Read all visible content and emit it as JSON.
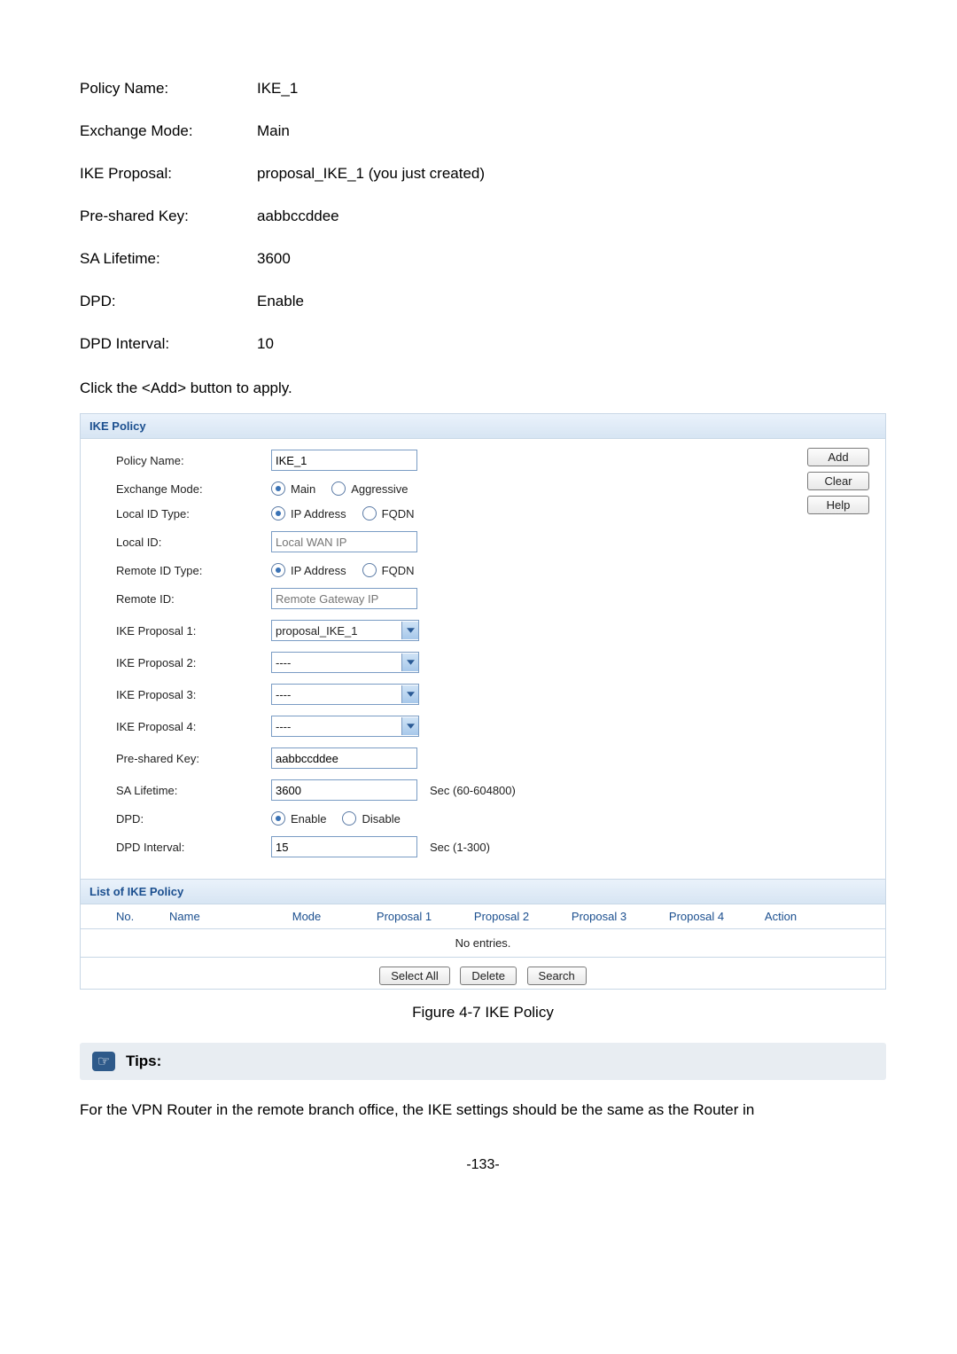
{
  "spec": {
    "rows": [
      {
        "label": "Policy Name:",
        "value": "IKE_1"
      },
      {
        "label": "Exchange Mode:",
        "value": "Main"
      },
      {
        "label": "IKE Proposal:",
        "value": "proposal_IKE_1 (you just created)"
      },
      {
        "label": "Pre-shared Key:",
        "value": "aabbccddee"
      },
      {
        "label": "SA Lifetime:",
        "value": "3600"
      },
      {
        "label": "DPD:",
        "value": "Enable"
      },
      {
        "label": "DPD Interval:",
        "value": "10"
      }
    ],
    "instruction": "Click the <Add> button to apply."
  },
  "panel": {
    "title": "IKE Policy",
    "side_buttons": {
      "add": "Add",
      "clear": "Clear",
      "help": "Help"
    },
    "policy_name": {
      "label": "Policy Name:",
      "value": "IKE_1"
    },
    "exchange_mode": {
      "label": "Exchange Mode:",
      "opt1": "Main",
      "opt2": "Aggressive"
    },
    "local_id_type": {
      "label": "Local ID Type:",
      "opt1": "IP Address",
      "opt2": "FQDN"
    },
    "local_id": {
      "label": "Local ID:",
      "placeholder": "Local WAN IP"
    },
    "remote_id_type": {
      "label": "Remote ID Type:",
      "opt1": "IP Address",
      "opt2": "FQDN"
    },
    "remote_id": {
      "label": "Remote ID:",
      "placeholder": "Remote Gateway IP"
    },
    "ike_proposal_1": {
      "label": "IKE Proposal 1:",
      "value": "proposal_IKE_1"
    },
    "ike_proposal_2": {
      "label": "IKE Proposal 2:",
      "value": "----"
    },
    "ike_proposal_3": {
      "label": "IKE Proposal 3:",
      "value": "----"
    },
    "ike_proposal_4": {
      "label": "IKE Proposal 4:",
      "value": "----"
    },
    "preshared_key": {
      "label": "Pre-shared Key:",
      "value": "aabbccddee"
    },
    "sa_lifetime": {
      "label": "SA Lifetime:",
      "value": "3600",
      "hint": "Sec (60-604800)"
    },
    "dpd": {
      "label": "DPD:",
      "opt1": "Enable",
      "opt2": "Disable"
    },
    "dpd_interval": {
      "label": "DPD Interval:",
      "value": "15",
      "hint": "Sec (1-300)"
    }
  },
  "list": {
    "title": "List of IKE Policy",
    "columns": {
      "no": "No.",
      "name": "Name",
      "mode": "Mode",
      "p1": "Proposal 1",
      "p2": "Proposal 2",
      "p3": "Proposal 3",
      "p4": "Proposal 4",
      "action": "Action"
    },
    "empty": "No entries.",
    "buttons": {
      "select_all": "Select All",
      "delete": "Delete",
      "search": "Search"
    }
  },
  "figure_caption": "Figure 4-7 IKE Policy",
  "tips": {
    "label": "Tips:"
  },
  "body_text": "For the VPN Router in the remote branch office, the IKE settings should be the same as the Router in",
  "page_number": "-133-"
}
